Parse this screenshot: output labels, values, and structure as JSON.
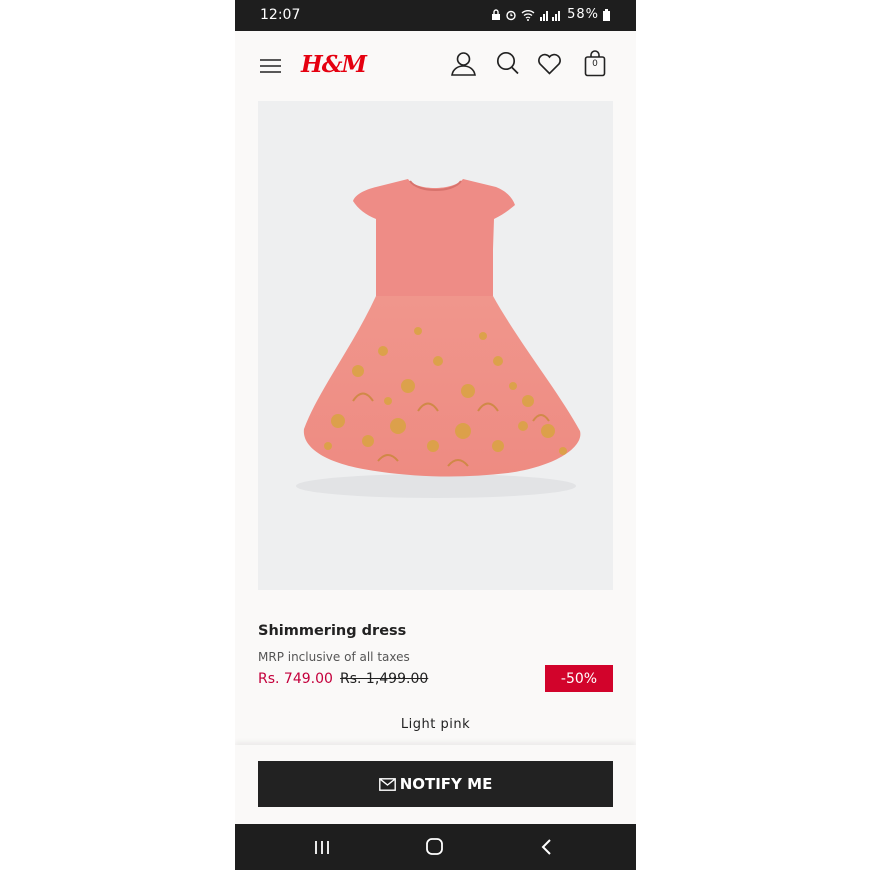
{
  "status_bar": {
    "time": "12:07",
    "battery": "58%"
  },
  "header": {
    "logo_text": "H&M",
    "bag_count": "0"
  },
  "product": {
    "name": "Shimmering dress",
    "tax_note": "MRP inclusive of all taxes",
    "sale_price": "Rs. 749.00",
    "original_price": "Rs. 1,499.00",
    "discount_badge": "-50%",
    "color_name": "Light pink"
  },
  "actions": {
    "notify_label": "NOTIFY ME"
  },
  "colors": {
    "brand_red": "#e50010",
    "sale_red": "#c4003c",
    "badge_red": "#d2032b",
    "button_dark": "#222222"
  },
  "icons": [
    "menu-icon",
    "account-icon",
    "search-icon",
    "heart-icon",
    "bag-icon",
    "mail-icon",
    "recent-apps-icon",
    "home-icon",
    "back-icon"
  ]
}
